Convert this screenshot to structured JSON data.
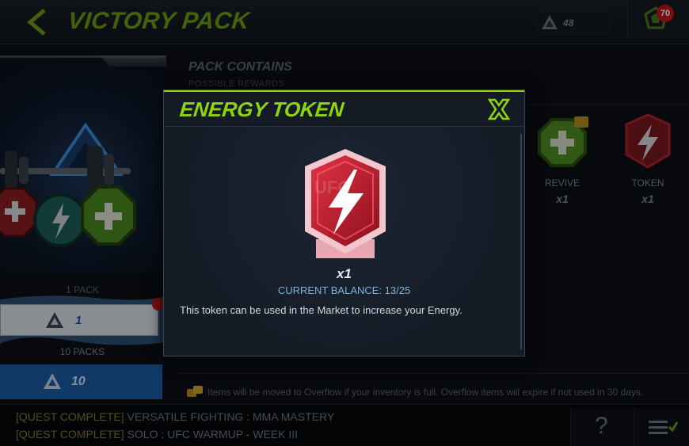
{
  "header": {
    "title": "VICTORY PACK",
    "currency_value": "48",
    "inbox_badge": "70"
  },
  "pack": {
    "single_label": "1 PACK",
    "single_cost": "1",
    "bundle_label": "10 PACKS",
    "bundle_cost": "10"
  },
  "contents": {
    "title": "PACK CONTAINS",
    "subtitle": "POSSIBLE REWARDS",
    "rewards": [
      {
        "name": "REVIVE",
        "qty": "x1"
      },
      {
        "name": "TOKEN",
        "qty": "x1"
      }
    ],
    "overflow_note": "Items will be moved to Overflow if your inventory is full. Overflow items will expire if not used in 30 days."
  },
  "ticker": {
    "quests": [
      {
        "tag": "[QUEST COMPLETE]",
        "text": " VERSATILE FIGHTING : MMA MASTERY"
      },
      {
        "tag": "[QUEST COMPLETE]",
        "text": " SOLO : UFC WARMUP - WEEK III"
      }
    ],
    "help_label": "?"
  },
  "modal": {
    "title": "ENERGY TOKEN",
    "quantity": "x1",
    "balance": "CURRENT BALANCE: 13/25",
    "description": "This token can be used in the Market to increase your Energy."
  },
  "colors": {
    "accent_green": "#8ed511",
    "token_red": "#c8102e",
    "bundle_blue": "#1a5ca7"
  }
}
